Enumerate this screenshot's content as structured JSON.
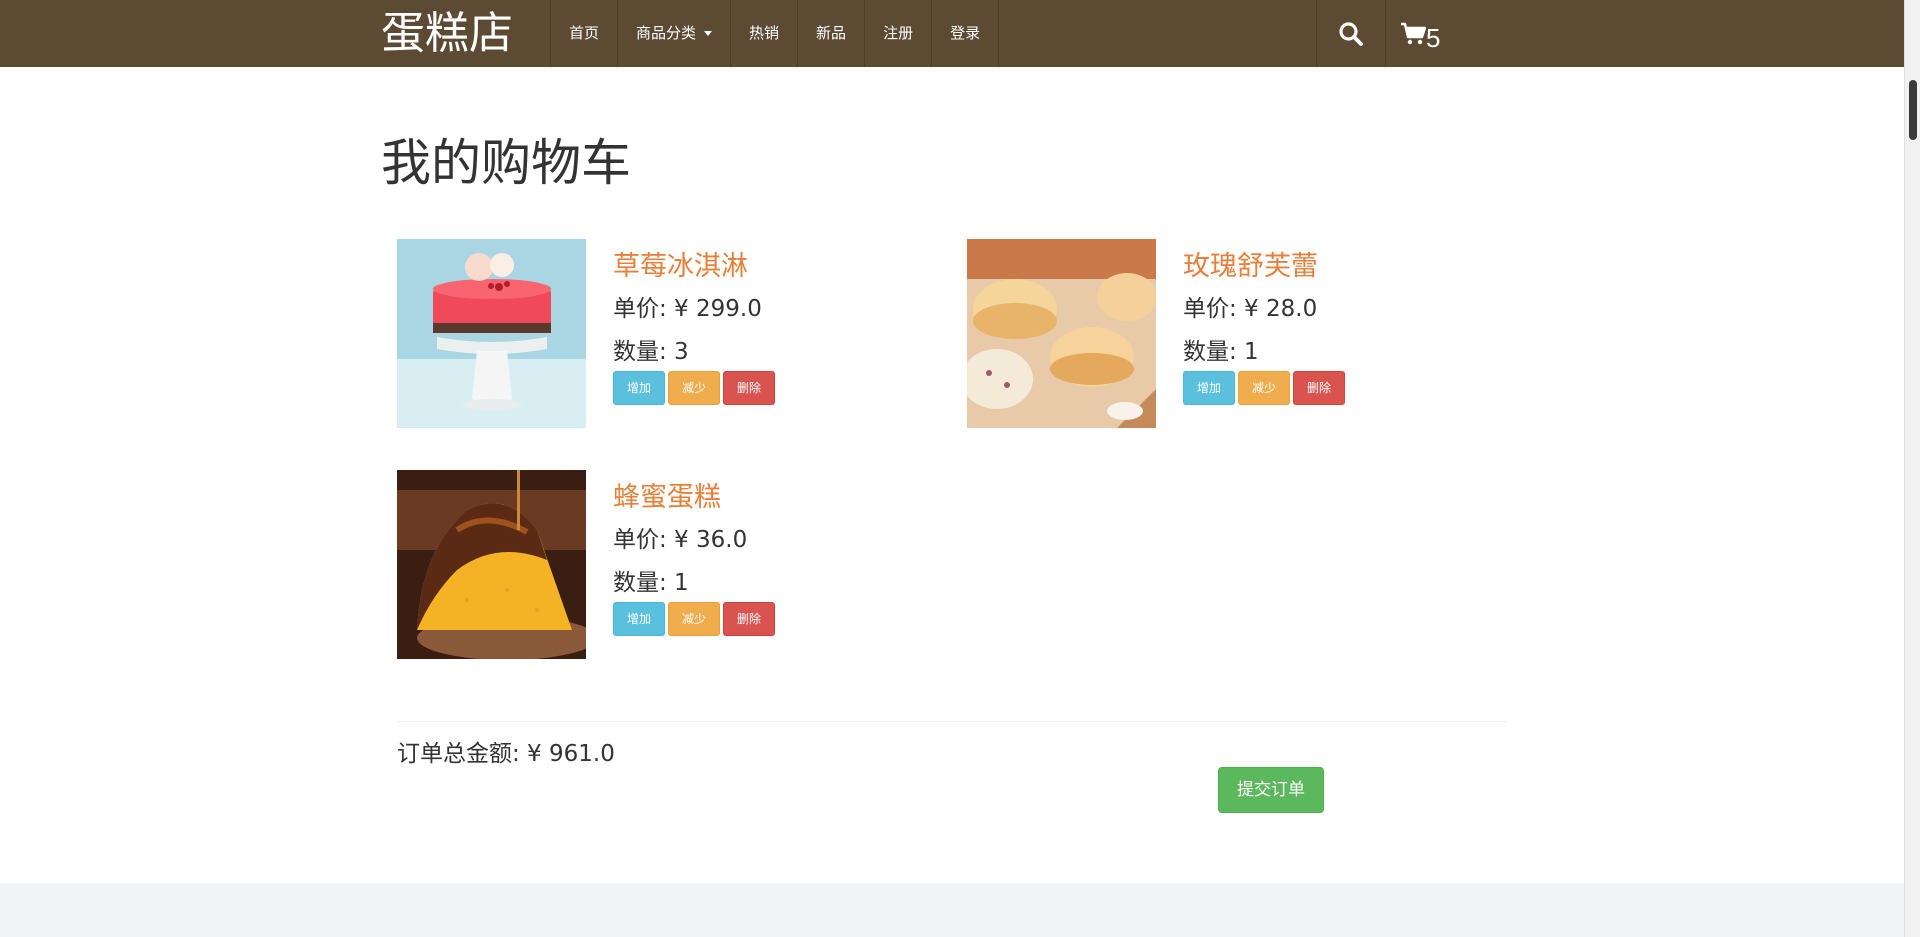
{
  "header": {
    "brand": "蛋糕店",
    "nav": [
      {
        "label": "首页"
      },
      {
        "label": "商品分类"
      },
      {
        "label": "热销"
      },
      {
        "label": "新品"
      },
      {
        "label": "注册"
      },
      {
        "label": "登录"
      }
    ],
    "search_icon": "search-icon",
    "cart_icon": "cart-icon",
    "cart_count": "5"
  },
  "main": {
    "title": "我的购物车",
    "items": [
      {
        "name": "草莓冰淇淋",
        "price": "单价: ¥ 299.0",
        "qty": "数量: 3",
        "add": "增加",
        "dec": "减少",
        "del": "删除"
      },
      {
        "name": "玫瑰舒芙蕾",
        "price": "单价: ¥ 28.0",
        "qty": "数量: 1",
        "add": "增加",
        "dec": "减少",
        "del": "删除"
      },
      {
        "name": "蜂蜜蛋糕",
        "price": "单价: ¥ 36.0",
        "qty": "数量: 1",
        "add": "增加",
        "dec": "减少",
        "del": "删除"
      }
    ],
    "total": "订单总金额: ¥ 961.0",
    "submit": "提交订单"
  },
  "colors": {
    "navbar": "#5d4a32",
    "item_name": "#e87f3a",
    "btn_add": "#5bc0de",
    "btn_dec": "#f0ad4e",
    "btn_del": "#d9534f",
    "btn_submit": "#5cb85c"
  }
}
